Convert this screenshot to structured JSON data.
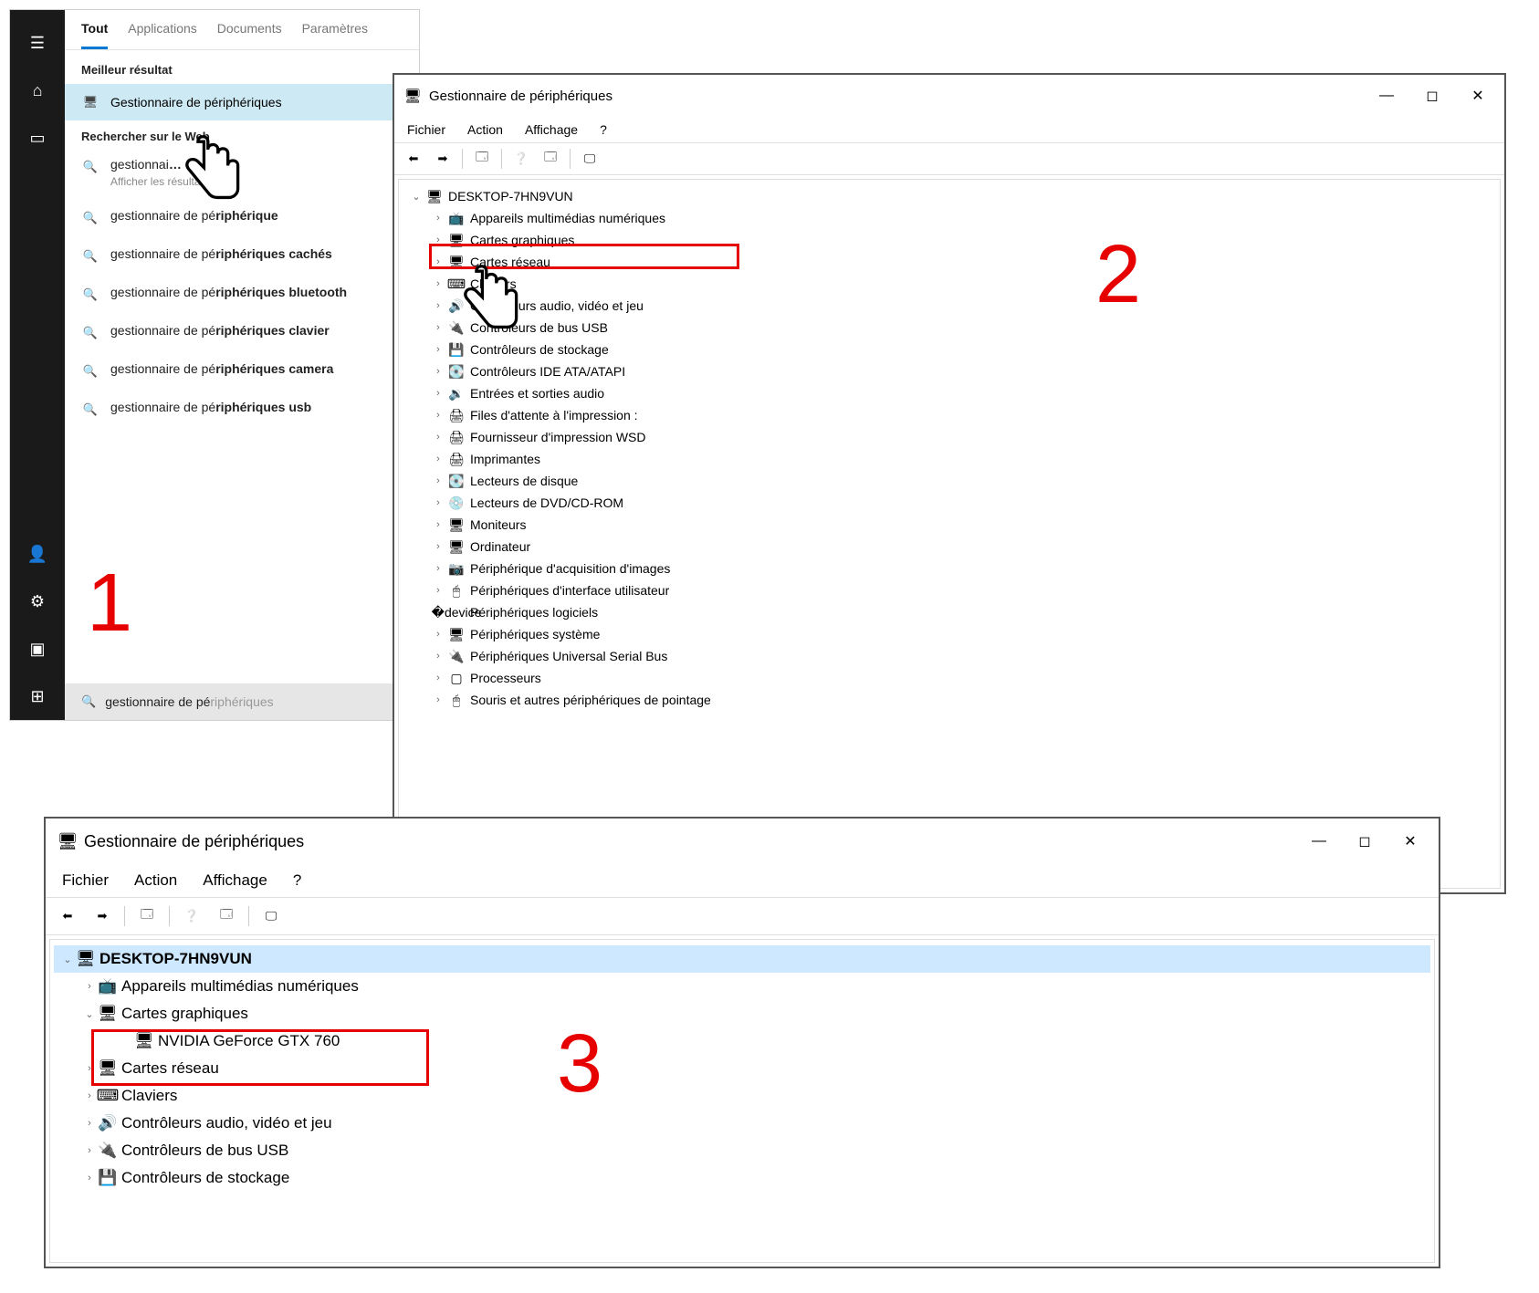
{
  "badges": {
    "one": "1",
    "two": "2",
    "three": "3"
  },
  "start": {
    "tabs": [
      "Tout",
      "Applications",
      "Documents",
      "Paramètres"
    ],
    "best_label": "Meilleur résultat",
    "best_result": "Gestionnaire de périphériques",
    "search_on_label": "Rechercher sur le Web",
    "suggestions": [
      {
        "pre": "gestionnai",
        "bold": "…",
        "sub": "Afficher les résultats Web"
      },
      {
        "pre": "gestionnaire de pé",
        "bold": "riphérique",
        "sub": ""
      },
      {
        "pre": "gestionnaire de pé",
        "bold": "riphériques cachés",
        "sub": ""
      },
      {
        "pre": "gestionnaire de pé",
        "bold": "riphériques bluetooth",
        "sub": ""
      },
      {
        "pre": "gestionnaire de pé",
        "bold": "riphériques clavier",
        "sub": ""
      },
      {
        "pre": "gestionnaire de pé",
        "bold": "riphériques camera",
        "sub": ""
      },
      {
        "pre": "gestionnaire de pé",
        "bold": "riphériques usb",
        "sub": ""
      }
    ],
    "typed": "gestionnaire de pé",
    "ghost": "riphériques"
  },
  "dm": {
    "title": "Gestionnaire de périphériques",
    "menu": [
      "Fichier",
      "Action",
      "Affichage",
      "?"
    ],
    "root": "DESKTOP-7HN9VUN",
    "categories2": [
      "Appareils multimédias numériques",
      "Cartes graphiques",
      "Cartes réseau",
      "Claviers",
      "Contrôleurs audio, vidéo et jeu",
      "Contrôleurs de bus USB",
      "Contrôleurs de stockage",
      "Contrôleurs IDE ATA/ATAPI",
      "Entrées et sorties audio",
      "Files d'attente à l'impression :",
      "Fournisseur d'impression WSD",
      "Imprimantes",
      "Lecteurs de disque",
      "Lecteurs de DVD/CD-ROM",
      "Moniteurs",
      "Ordinateur",
      "Périphérique d'acquisition d'images",
      "Périphériques d'interface utilisateur",
      "Périphériques logiciels",
      "Périphériques système",
      "Périphériques Universal Serial Bus",
      "Processeurs",
      "Souris et autres périphériques de pointage"
    ],
    "categories3": [
      "Appareils multimédias numériques",
      "Cartes graphiques",
      "Cartes réseau",
      "Claviers",
      "Contrôleurs audio, vidéo et jeu",
      "Contrôleurs de bus USB",
      "Contrôleurs de stockage"
    ],
    "gpu": "NVIDIA GeForce GTX 760"
  }
}
